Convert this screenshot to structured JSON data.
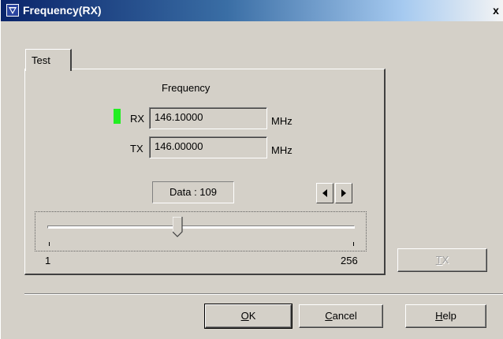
{
  "window": {
    "title": "Frequency(RX)",
    "close_glyph": "x"
  },
  "tab": {
    "label": "Test"
  },
  "panel": {
    "heading": "Frequency",
    "rx_label": "RX",
    "rx_value": "146.10000",
    "rx_unit": "MHz",
    "tx_label": "TX",
    "tx_value": "146.00000",
    "tx_unit": "MHz",
    "data_readout": "Data : 109",
    "slider": {
      "min_label": "1",
      "max_label": "256",
      "min": 1,
      "max": 256,
      "value": 109
    },
    "rx_indicator_color": "#22ee22"
  },
  "buttons": {
    "tx": {
      "label": "TX",
      "mnemonic": "T",
      "rest": "X",
      "enabled": false
    },
    "ok": {
      "mnemonic": "O",
      "rest": "K"
    },
    "cancel": {
      "mnemonic": "C",
      "rest": "ancel"
    },
    "help": {
      "mnemonic": "H",
      "rest": "elp"
    }
  },
  "icons": {
    "title_icon": "app-down-triangle-icon",
    "prev": "arrow-left-icon",
    "next": "arrow-right-icon"
  }
}
